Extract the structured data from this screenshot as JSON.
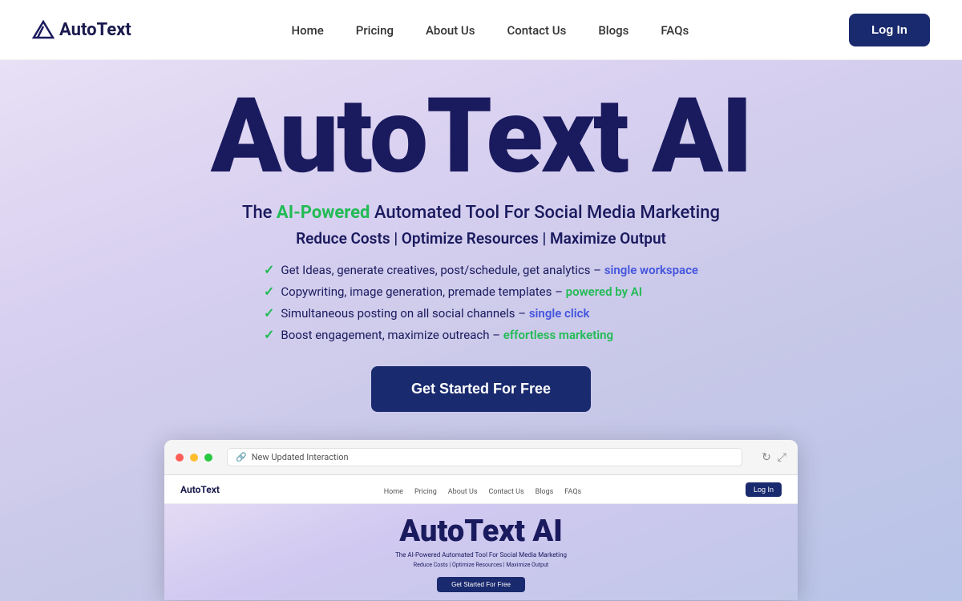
{
  "brand": {
    "name": "AutoText",
    "logo_text": "AutoText"
  },
  "navbar": {
    "links": [
      {
        "id": "home",
        "label": "Home"
      },
      {
        "id": "pricing",
        "label": "Pricing"
      },
      {
        "id": "about",
        "label": "About Us"
      },
      {
        "id": "contact",
        "label": "Contact Us"
      },
      {
        "id": "blogs",
        "label": "Blogs"
      },
      {
        "id": "faqs",
        "label": "FAQs"
      }
    ],
    "login_label": "Log In"
  },
  "hero": {
    "title": "AutoText AI",
    "subtitle_prefix": "The ",
    "subtitle_highlight": "AI-Powered",
    "subtitle_suffix": " Automated Tool For Social Media Marketing",
    "tagline": "Reduce Costs | Optimize Resources | Maximize Output",
    "features": [
      {
        "text": "Get Ideas, generate creatives, post/schedule, get analytics –",
        "highlight": "single workspace",
        "highlight_color": "blue"
      },
      {
        "text": "Copywriting, image generation, premade templates –",
        "highlight": "powered by AI",
        "highlight_color": "green"
      },
      {
        "text": "Simultaneous posting on all social channels –",
        "highlight": "single click",
        "highlight_color": "blue"
      },
      {
        "text": "Boost engagement, maximize outreach –",
        "highlight": "effortless marketing",
        "highlight_color": "green"
      }
    ],
    "cta_label": "Get Started For Free"
  },
  "browser_mockup": {
    "url_text": "New Updated Interaction",
    "mini_nav": {
      "logo": "AutoText",
      "links": [
        "Home",
        "Pricing",
        "About Us",
        "Contact Us",
        "Blogs",
        "FAQs"
      ],
      "login": "Log In"
    },
    "mini_hero_title": "AutoText AI",
    "mini_subtitle": "The AI-Powered Automated Tool For Social Media Marketing",
    "mini_tagline": "Reduce Costs | Optimize Resources | Maximize Output",
    "mini_cta": "Get Started For Free"
  },
  "colors": {
    "brand_dark": "#1a1a5e",
    "brand_navy": "#1a2a6e",
    "accent_green": "#22bb55",
    "accent_blue": "#4455dd",
    "hero_bg_start": "#e8e0f5",
    "hero_bg_end": "#b8c4e8"
  }
}
